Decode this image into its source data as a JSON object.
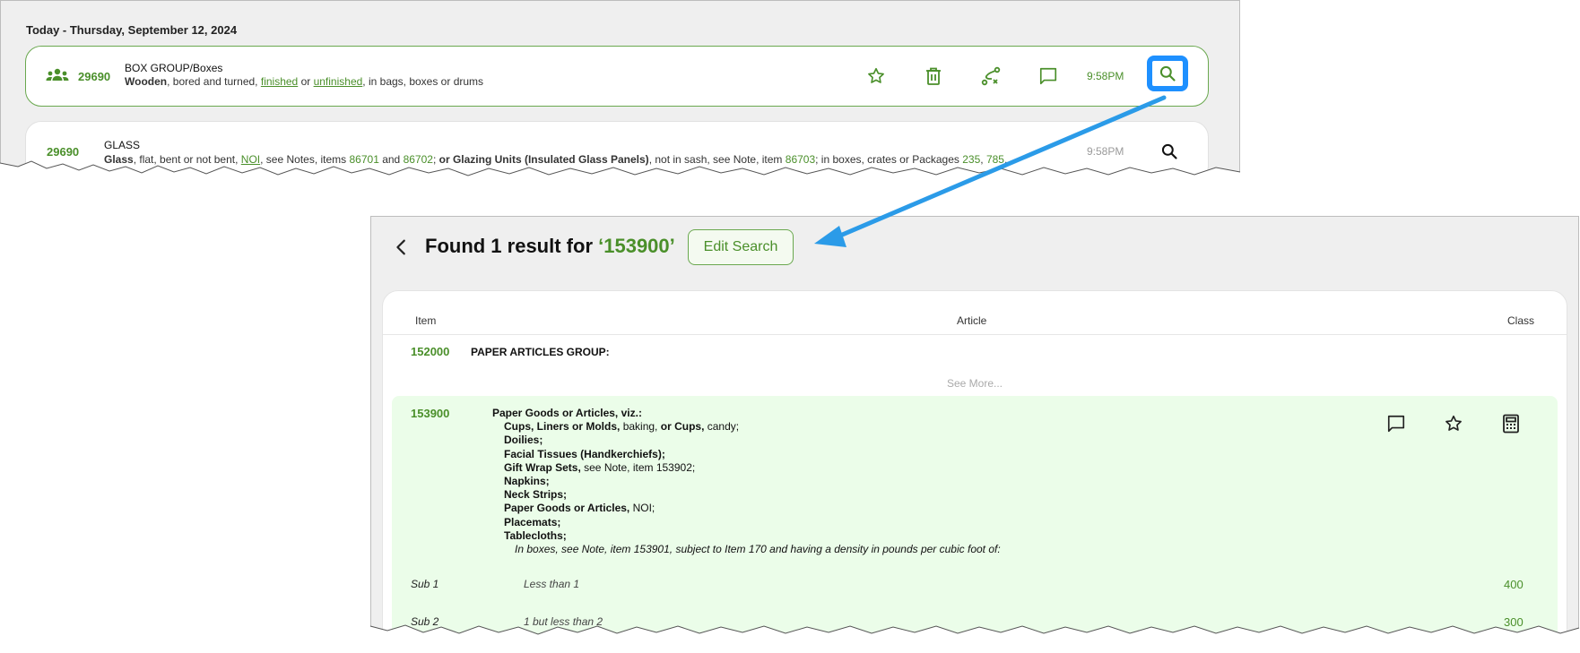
{
  "history": {
    "date_heading": "Today - Thursday, September 12, 2024",
    "rows": [
      {
        "item": "29690",
        "title": "BOX GROUP/Boxes",
        "desc_bold": "Wooden",
        "desc_1": ", bored and turned, ",
        "link_1": "finished",
        "desc_2": " or ",
        "link_2": "unfinished",
        "desc_3": ", in bags, boxes or drums",
        "time": "9:58PM"
      },
      {
        "item": "29690",
        "title": "GLASS",
        "desc_bold_1": "Glass",
        "desc_1": ", flat, bent or not bent, ",
        "link_1": "NOI",
        "desc_2": ", see Notes, items ",
        "num_1": "86701",
        "desc_3": " and ",
        "num_2": "86702",
        "desc_4": "; ",
        "desc_bold_2": "or Glazing Units (Insulated Glass Panels)",
        "desc_5": ", not in sash, see Note, item ",
        "num_3": "86703",
        "desc_6": "; in boxes, crates or Packages ",
        "num_4": "235",
        "desc_7": ", ",
        "num_5": "785",
        "desc_8": ",...",
        "time": "9:58PM"
      }
    ]
  },
  "results": {
    "found_prefix": "Found 1 result for ",
    "query": "‘153900’",
    "edit_search_label": "Edit Search",
    "columns": {
      "item": "Item",
      "article": "Article",
      "class": "Class"
    },
    "group": {
      "item": "152000",
      "title": "PAPER ARTICLES GROUP:"
    },
    "see_more": "See More...",
    "highlight": {
      "item": "153900",
      "heading": "Paper Goods or Articles, viz.:",
      "lines": [
        {
          "bold": "Cups, Liners or Molds,",
          "rest": " baking, ",
          "bold2": "or Cups,",
          "rest2": " candy;"
        },
        {
          "bold": "Doilies;",
          "rest": "",
          "bold2": "",
          "rest2": ""
        },
        {
          "bold": "Facial Tissues (Handkerchiefs);",
          "rest": "",
          "bold2": "",
          "rest2": ""
        },
        {
          "bold": "Gift Wrap Sets,",
          "rest": " see Note, item 153902;",
          "bold2": "",
          "rest2": ""
        },
        {
          "bold": "Napkins;",
          "rest": "",
          "bold2": "",
          "rest2": ""
        },
        {
          "bold": "Neck Strips;",
          "rest": "",
          "bold2": "",
          "rest2": ""
        },
        {
          "bold": "Paper Goods or Articles,",
          "rest": " NOI;",
          "bold2": "",
          "rest2": ""
        },
        {
          "bold": "Placemats;",
          "rest": "",
          "bold2": "",
          "rest2": ""
        },
        {
          "bold": "Tablecloths;",
          "rest": "",
          "bold2": "",
          "rest2": ""
        }
      ],
      "note": "In boxes, see Note, item 153901, subject to Item 170 and having a density in pounds per cubic foot of:",
      "subs": [
        {
          "label": "Sub 1",
          "range": "Less than 1",
          "class": "400"
        },
        {
          "label": "Sub 2",
          "range": "1 but less than 2",
          "class": "300"
        }
      ]
    }
  },
  "icons": {
    "group": "group-icon",
    "star": "star-icon",
    "trash": "trash-icon",
    "route": "route-icon",
    "comment": "comment-icon",
    "search": "search-icon",
    "back": "chevron-left-icon",
    "calculator": "calculator-icon"
  },
  "colors": {
    "accent": "#4a8f2a",
    "highlight_bg": "#ebfde9",
    "callout": "#1e90ff",
    "arrow": "#2b9be8"
  }
}
